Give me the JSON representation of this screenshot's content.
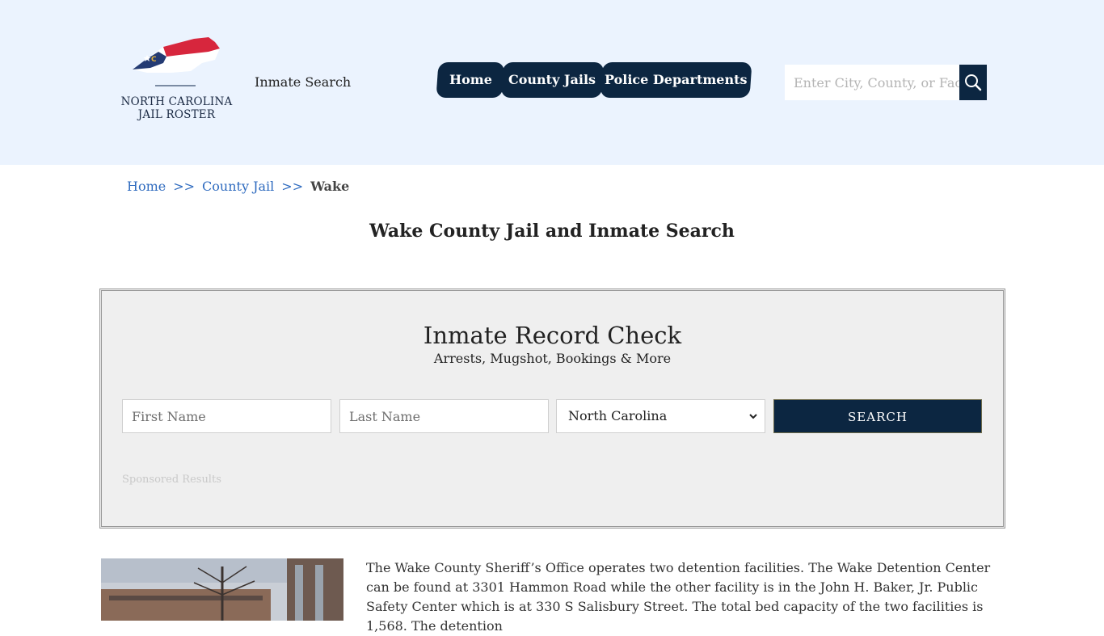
{
  "header": {
    "logo": {
      "line1": "NORTH CAROLINA",
      "line2": "JAIL ROSTER",
      "flag_colors": {
        "red": "#d7263d",
        "blue": "#243b73",
        "white": "#ffffff",
        "gold": "#e3b23c"
      }
    },
    "inmate_search_label": "Inmate Search",
    "nav": [
      {
        "label": "Home"
      },
      {
        "label": "County Jails"
      },
      {
        "label": "Police Departments"
      }
    ],
    "search": {
      "placeholder": "Enter City, County, or Facility",
      "icon": "search-icon"
    }
  },
  "breadcrumb": {
    "items": [
      "Home",
      "County Jail"
    ],
    "separator": ">>",
    "current": "Wake"
  },
  "page_title": "Wake County Jail and Inmate Search",
  "record_check": {
    "title": "Inmate Record Check",
    "subtitle": "Arrests, Mugshot, Bookings & More",
    "first_name_placeholder": "First Name",
    "last_name_placeholder": "Last Name",
    "state_selected": "North Carolina",
    "search_label": "SEARCH",
    "sponsored": "Sponsored Results"
  },
  "content": {
    "paragraph": "The Wake County Sheriff’s Office operates two detention facilities. The Wake Detention Center can be found at 3301 Hammon Road while the other facility is in the John H. Baker, Jr. Public Safety Center which is at 330 S Salisbury Street. The total bed capacity of the two facilities is 1,568. The detention"
  },
  "colors": {
    "header_bg": "#ebf3fe",
    "navy": "#0c2641",
    "link": "#2f6bbf",
    "panel_bg": "#efefef"
  }
}
